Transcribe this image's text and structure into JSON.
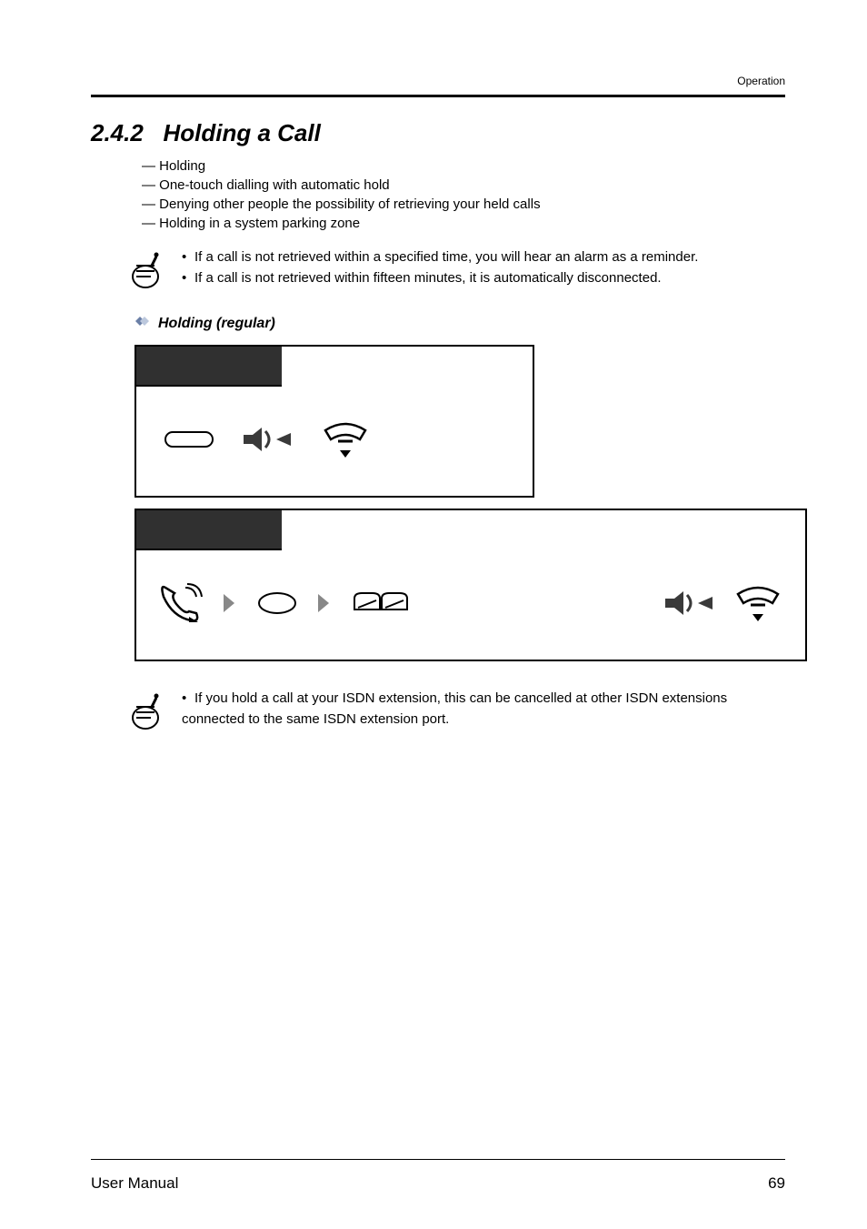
{
  "header": {
    "section": "Operation"
  },
  "section": {
    "number": "2.4.2",
    "title": "Holding a Call",
    "subitems": [
      "— Holding",
      "— One-touch dialling with automatic hold",
      "— Denying other people the possibility of retrieving your held calls",
      "— Holding in a system parking zone"
    ]
  },
  "notes_top": [
    "If a call is not retrieved within a specified time, you will hear an alarm as a reminder.",
    "If a call is not retrieved within fifteen minutes, it is automatically disconnected."
  ],
  "subhead": "Holding (regular)",
  "notes_bottom": [
    "If you hold a call at your ISDN extension, this can be cancelled at other ISDN extensions connected to the same ISDN extension port."
  ],
  "footer": {
    "left": "User Manual",
    "right": "69"
  }
}
